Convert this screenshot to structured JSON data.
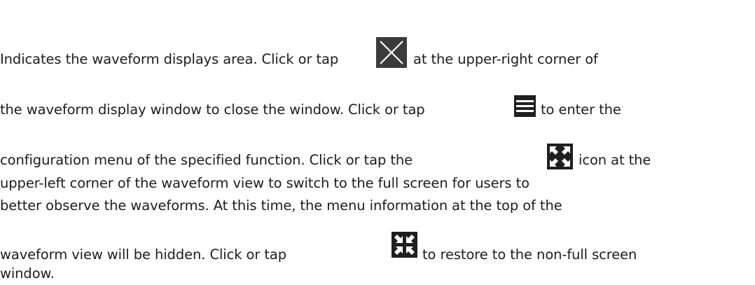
{
  "paragraph": {
    "line1_a": "Indicates the waveform displays area. Click or tap",
    "line1_b": "at the upper-right corner of",
    "line2_a": "the waveform display window to close the window. Click or tap",
    "line2_b": "to enter the",
    "line3_a": "configuration menu of the specified function. Click or tap the",
    "line3_b": "icon at the",
    "line4": "upper-left corner of the waveform view to switch to the full screen for users to",
    "line5": "better observe the waveforms. At this time, the menu information at the top of the",
    "line6_a": "waveform view will be hidden. Click or tap",
    "line6_b": "to restore to the non-full screen",
    "line7": "window."
  },
  "icons": {
    "close": "close-icon",
    "menu": "menu-icon",
    "fullscreen": "fullscreen-icon",
    "exit_fullscreen": "exit-fullscreen-icon"
  },
  "colors": {
    "text": "#1c1c1c",
    "icon_bg": "#1f1f1f",
    "close_bg": "#3b3b3b",
    "icon_fg": "#ffffff"
  }
}
